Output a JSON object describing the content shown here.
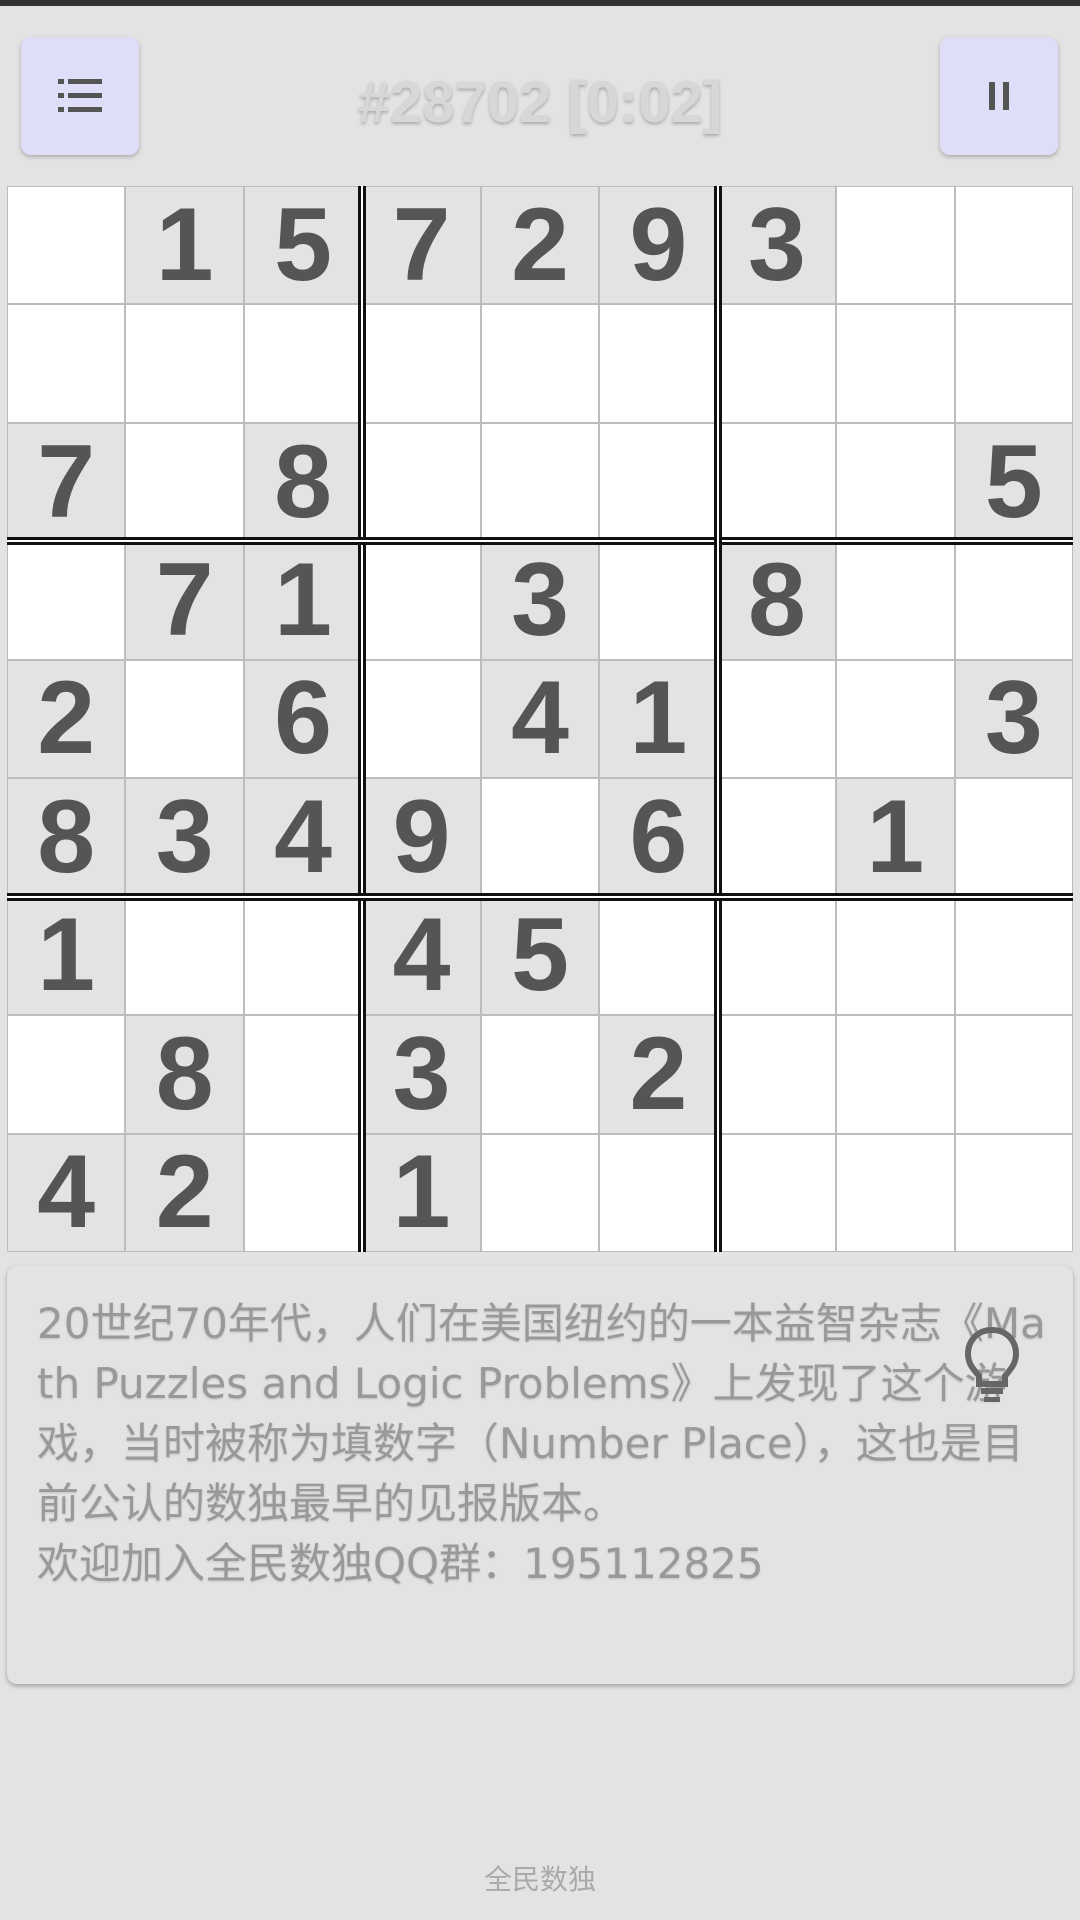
{
  "header": {
    "title": "#28702 [0:02]",
    "menu_icon": "list-icon",
    "pause_icon": "pause-icon"
  },
  "board": {
    "grid": [
      [
        0,
        1,
        5,
        7,
        2,
        9,
        3,
        0,
        0
      ],
      [
        0,
        0,
        0,
        0,
        0,
        0,
        0,
        0,
        0
      ],
      [
        7,
        0,
        8,
        0,
        0,
        0,
        0,
        0,
        5
      ],
      [
        0,
        7,
        1,
        0,
        3,
        0,
        8,
        0,
        0
      ],
      [
        2,
        0,
        6,
        0,
        4,
        1,
        0,
        0,
        3
      ],
      [
        8,
        3,
        4,
        9,
        0,
        6,
        0,
        1,
        0
      ],
      [
        1,
        0,
        0,
        4,
        5,
        0,
        0,
        0,
        0
      ],
      [
        0,
        8,
        0,
        3,
        0,
        2,
        0,
        0,
        0
      ],
      [
        4,
        2,
        0,
        1,
        0,
        0,
        0,
        0,
        0
      ]
    ]
  },
  "tip": {
    "text": "20世纪70年代，人们在美国纽约的一本益智杂志《Math Puzzles and Logic Problems》上发现了这个游戏，当时被称为填数字（Number Place），这也是目前公认的数独最早的见报版本。\n欢迎加入全民数独QQ群：195112825",
    "icon": "lightbulb-icon"
  },
  "footer": {
    "label": "全民数独"
  },
  "colors": {
    "background": "#e3e3e3",
    "given_cell": "#e3e3e3",
    "empty_cell": "#ffffff",
    "digit": "#555555",
    "button": "#dedef8"
  }
}
